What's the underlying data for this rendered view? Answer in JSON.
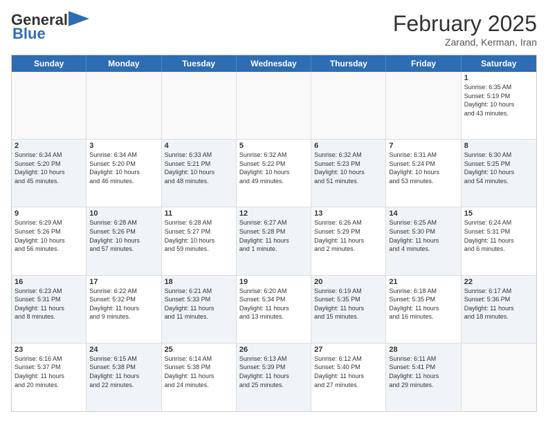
{
  "header": {
    "logo_general": "General",
    "logo_blue": "Blue",
    "main_title": "February 2025",
    "subtitle": "Zarand, Kerman, Iran"
  },
  "weekdays": [
    "Sunday",
    "Monday",
    "Tuesday",
    "Wednesday",
    "Thursday",
    "Friday",
    "Saturday"
  ],
  "weeks": [
    [
      {
        "day": "",
        "info": "",
        "shaded": false,
        "empty": true
      },
      {
        "day": "",
        "info": "",
        "shaded": false,
        "empty": true
      },
      {
        "day": "",
        "info": "",
        "shaded": false,
        "empty": true
      },
      {
        "day": "",
        "info": "",
        "shaded": false,
        "empty": true
      },
      {
        "day": "",
        "info": "",
        "shaded": false,
        "empty": true
      },
      {
        "day": "",
        "info": "",
        "shaded": false,
        "empty": true
      },
      {
        "day": "1",
        "info": "Sunrise: 6:35 AM\nSunset: 5:19 PM\nDaylight: 10 hours\nand 43 minutes.",
        "shaded": false,
        "empty": false
      }
    ],
    [
      {
        "day": "2",
        "info": "Sunrise: 6:34 AM\nSunset: 5:20 PM\nDaylight: 10 hours\nand 45 minutes.",
        "shaded": true,
        "empty": false
      },
      {
        "day": "3",
        "info": "Sunrise: 6:34 AM\nSunset: 5:20 PM\nDaylight: 10 hours\nand 46 minutes.",
        "shaded": false,
        "empty": false
      },
      {
        "day": "4",
        "info": "Sunrise: 6:33 AM\nSunset: 5:21 PM\nDaylight: 10 hours\nand 48 minutes.",
        "shaded": true,
        "empty": false
      },
      {
        "day": "5",
        "info": "Sunrise: 6:32 AM\nSunset: 5:22 PM\nDaylight: 10 hours\nand 49 minutes.",
        "shaded": false,
        "empty": false
      },
      {
        "day": "6",
        "info": "Sunrise: 6:32 AM\nSunset: 5:23 PM\nDaylight: 10 hours\nand 51 minutes.",
        "shaded": true,
        "empty": false
      },
      {
        "day": "7",
        "info": "Sunrise: 6:31 AM\nSunset: 5:24 PM\nDaylight: 10 hours\nand 53 minutes.",
        "shaded": false,
        "empty": false
      },
      {
        "day": "8",
        "info": "Sunrise: 6:30 AM\nSunset: 5:25 PM\nDaylight: 10 hours\nand 54 minutes.",
        "shaded": true,
        "empty": false
      }
    ],
    [
      {
        "day": "9",
        "info": "Sunrise: 6:29 AM\nSunset: 5:26 PM\nDaylight: 10 hours\nand 56 minutes.",
        "shaded": false,
        "empty": false
      },
      {
        "day": "10",
        "info": "Sunrise: 6:28 AM\nSunset: 5:26 PM\nDaylight: 10 hours\nand 57 minutes.",
        "shaded": true,
        "empty": false
      },
      {
        "day": "11",
        "info": "Sunrise: 6:28 AM\nSunset: 5:27 PM\nDaylight: 10 hours\nand 59 minutes.",
        "shaded": false,
        "empty": false
      },
      {
        "day": "12",
        "info": "Sunrise: 6:27 AM\nSunset: 5:28 PM\nDaylight: 11 hours\nand 1 minute.",
        "shaded": true,
        "empty": false
      },
      {
        "day": "13",
        "info": "Sunrise: 6:26 AM\nSunset: 5:29 PM\nDaylight: 11 hours\nand 2 minutes.",
        "shaded": false,
        "empty": false
      },
      {
        "day": "14",
        "info": "Sunrise: 6:25 AM\nSunset: 5:30 PM\nDaylight: 11 hours\nand 4 minutes.",
        "shaded": true,
        "empty": false
      },
      {
        "day": "15",
        "info": "Sunrise: 6:24 AM\nSunset: 5:31 PM\nDaylight: 11 hours\nand 6 minutes.",
        "shaded": false,
        "empty": false
      }
    ],
    [
      {
        "day": "16",
        "info": "Sunrise: 6:23 AM\nSunset: 5:31 PM\nDaylight: 11 hours\nand 8 minutes.",
        "shaded": true,
        "empty": false
      },
      {
        "day": "17",
        "info": "Sunrise: 6:22 AM\nSunset: 5:32 PM\nDaylight: 11 hours\nand 9 minutes.",
        "shaded": false,
        "empty": false
      },
      {
        "day": "18",
        "info": "Sunrise: 6:21 AM\nSunset: 5:33 PM\nDaylight: 11 hours\nand 11 minutes.",
        "shaded": true,
        "empty": false
      },
      {
        "day": "19",
        "info": "Sunrise: 6:20 AM\nSunset: 5:34 PM\nDaylight: 11 hours\nand 13 minutes.",
        "shaded": false,
        "empty": false
      },
      {
        "day": "20",
        "info": "Sunrise: 6:19 AM\nSunset: 5:35 PM\nDaylight: 11 hours\nand 15 minutes.",
        "shaded": true,
        "empty": false
      },
      {
        "day": "21",
        "info": "Sunrise: 6:18 AM\nSunset: 5:35 PM\nDaylight: 11 hours\nand 16 minutes.",
        "shaded": false,
        "empty": false
      },
      {
        "day": "22",
        "info": "Sunrise: 6:17 AM\nSunset: 5:36 PM\nDaylight: 11 hours\nand 18 minutes.",
        "shaded": true,
        "empty": false
      }
    ],
    [
      {
        "day": "23",
        "info": "Sunrise: 6:16 AM\nSunset: 5:37 PM\nDaylight: 11 hours\nand 20 minutes.",
        "shaded": false,
        "empty": false
      },
      {
        "day": "24",
        "info": "Sunrise: 6:15 AM\nSunset: 5:38 PM\nDaylight: 11 hours\nand 22 minutes.",
        "shaded": true,
        "empty": false
      },
      {
        "day": "25",
        "info": "Sunrise: 6:14 AM\nSunset: 5:38 PM\nDaylight: 11 hours\nand 24 minutes.",
        "shaded": false,
        "empty": false
      },
      {
        "day": "26",
        "info": "Sunrise: 6:13 AM\nSunset: 5:39 PM\nDaylight: 11 hours\nand 25 minutes.",
        "shaded": true,
        "empty": false
      },
      {
        "day": "27",
        "info": "Sunrise: 6:12 AM\nSunset: 5:40 PM\nDaylight: 11 hours\nand 27 minutes.",
        "shaded": false,
        "empty": false
      },
      {
        "day": "28",
        "info": "Sunrise: 6:11 AM\nSunset: 5:41 PM\nDaylight: 11 hours\nand 29 minutes.",
        "shaded": true,
        "empty": false
      },
      {
        "day": "",
        "info": "",
        "shaded": false,
        "empty": true
      }
    ]
  ]
}
